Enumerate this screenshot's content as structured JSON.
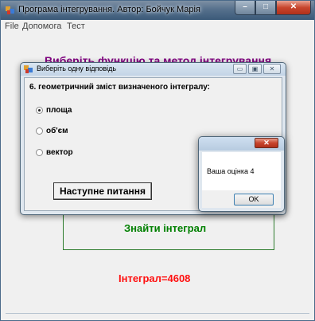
{
  "main_window": {
    "title": "Програма інтегрування. Автор: Бойчук Марія",
    "menu": [
      "File",
      "Допомога",
      "Тест"
    ],
    "header_title": "Виберіть функцію та метод інтегрування",
    "find_label": "Знайти інтеграл",
    "result_label": "Інтеграл=4608",
    "caption_buttons": [
      "minimize",
      "maximize",
      "close"
    ]
  },
  "question_dialog": {
    "title": "Виберіть одну відповідь",
    "question": "6. геометричний зміст визначеного інтегралу:",
    "options": [
      {
        "label": "площа",
        "checked": true
      },
      {
        "label": "об'єм",
        "checked": false
      },
      {
        "label": "вектор",
        "checked": false
      }
    ],
    "next_button": "Наступне питання"
  },
  "message_box": {
    "text": "Ваша оцінка  4",
    "ok_button": "OK"
  },
  "colors": {
    "header_title": "#800080",
    "find_label": "#008000",
    "result_label": "#ff1010",
    "find_box_border": "#2e7d2e"
  }
}
